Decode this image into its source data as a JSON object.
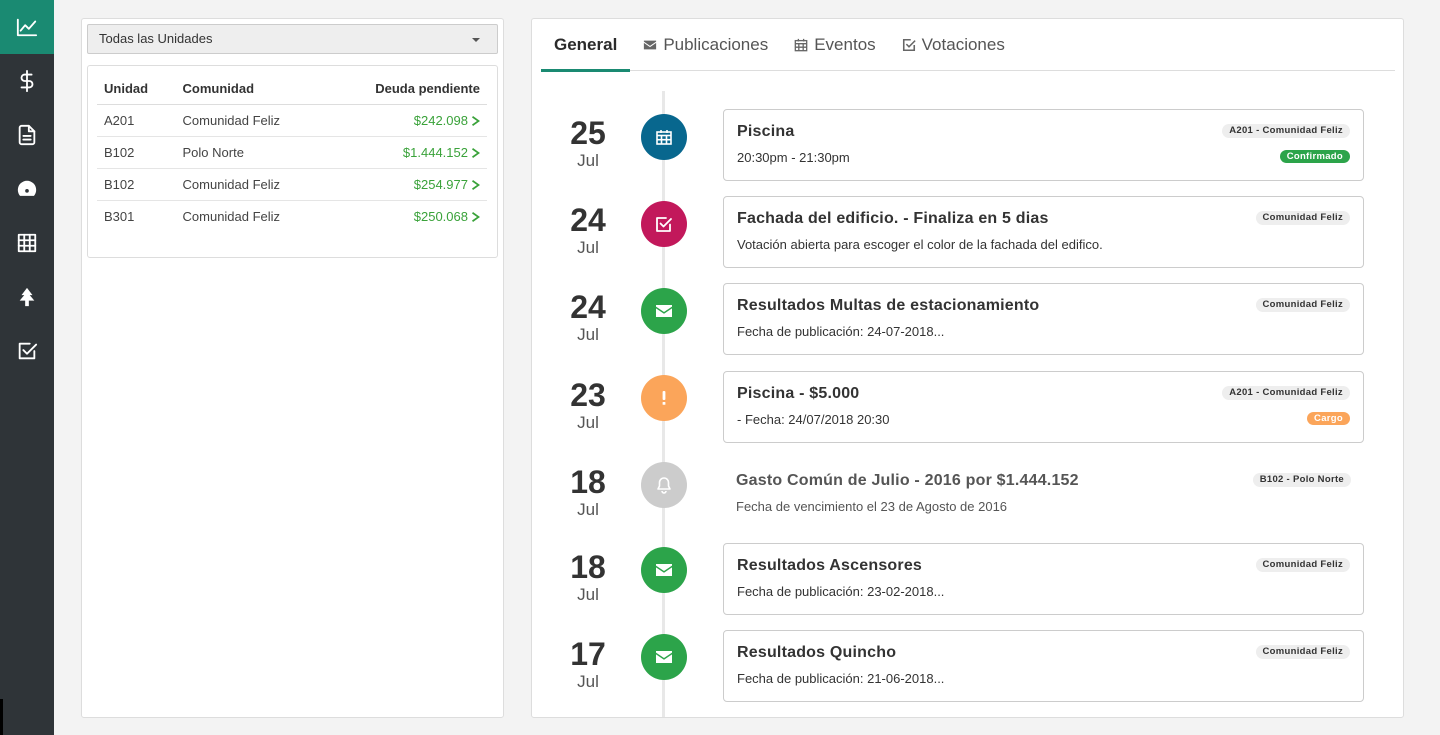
{
  "sidebar": {
    "items": [
      {
        "icon": "chart-line-icon",
        "active": true
      },
      {
        "icon": "dollar-icon",
        "active": false
      },
      {
        "icon": "document-icon",
        "active": false
      },
      {
        "icon": "dashboard-icon",
        "active": false
      },
      {
        "icon": "calendar-grid-icon",
        "active": false
      },
      {
        "icon": "tree-icon",
        "active": false
      },
      {
        "icon": "check-square-icon",
        "active": false
      }
    ]
  },
  "units": {
    "selected": "Todas las Unidades",
    "columns": [
      "Unidad",
      "Comunidad",
      "Deuda pendiente"
    ],
    "rows": [
      {
        "unit": "A201",
        "community": "Comunidad Feliz",
        "debt": "$242.098"
      },
      {
        "unit": "B102",
        "community": "Polo Norte",
        "debt": "$1.444.152"
      },
      {
        "unit": "B102",
        "community": "Comunidad Feliz",
        "debt": "$254.977"
      },
      {
        "unit": "B301",
        "community": "Comunidad Feliz",
        "debt": "$250.068"
      }
    ]
  },
  "tabs": [
    {
      "label": "General",
      "icon": "",
      "active": true
    },
    {
      "label": "Publicaciones",
      "icon": "envelope-icon",
      "active": false
    },
    {
      "label": "Eventos",
      "icon": "calendar-icon",
      "active": false
    },
    {
      "label": "Votaciones",
      "icon": "check-icon",
      "active": false
    }
  ],
  "colors": {
    "accent": "#1a8a72",
    "event": "#08678e",
    "vote": "#c2185b",
    "publication": "#2ca44a",
    "charge": "#fba55a",
    "expense": "#cccccc",
    "confirmed": "#2ca44a",
    "cargo": "#fba55a"
  },
  "timeline": [
    {
      "day": "25",
      "month": "Jul",
      "kind": "event",
      "icon": "calendar-icon",
      "title": "Piscina",
      "subtitle": "20:30pm - 21:30pm",
      "tag": "A201 - Comunidad Feliz",
      "badge": "Confirmado",
      "badge_color": "#2ca44a",
      "flat": false
    },
    {
      "day": "24",
      "month": "Jul",
      "kind": "vote",
      "icon": "check-square-icon",
      "title": "Fachada del edificio. - Finaliza en 5 dias",
      "subtitle": "Votación abierta para escoger el color de la fachada del edifico.",
      "tag": "Comunidad Feliz",
      "badge": "",
      "flat": false
    },
    {
      "day": "24",
      "month": "Jul",
      "kind": "publication",
      "icon": "envelope-icon",
      "title": "Resultados Multas de estacionamiento",
      "subtitle": "Fecha de publicación: 24-07-2018...",
      "tag": "Comunidad Feliz",
      "badge": "",
      "flat": false
    },
    {
      "day": "23",
      "month": "Jul",
      "kind": "charge",
      "icon": "exclamation-icon",
      "title": "Piscina - $5.000",
      "subtitle": "- Fecha: 24/07/2018 20:30",
      "tag": "A201 - Comunidad Feliz",
      "badge": "Cargo",
      "badge_color": "#fba55a",
      "flat": false
    },
    {
      "day": "18",
      "month": "Jul",
      "kind": "expense",
      "icon": "bell-icon",
      "title": "Gasto Común de Julio - 2016 por $1.444.152",
      "subtitle": "Fecha de vencimiento el 23 de Agosto de 2016",
      "tag": "B102 - Polo Norte",
      "badge": "",
      "flat": true
    },
    {
      "day": "18",
      "month": "Jul",
      "kind": "publication",
      "icon": "envelope-icon",
      "title": "Resultados Ascensores",
      "subtitle": "Fecha de publicación: 23-02-2018...",
      "tag": "Comunidad Feliz",
      "badge": "",
      "flat": false
    },
    {
      "day": "17",
      "month": "Jul",
      "kind": "publication",
      "icon": "envelope-icon",
      "title": "Resultados Quincho",
      "subtitle": "Fecha de publicación: 21-06-2018...",
      "tag": "Comunidad Feliz",
      "badge": "",
      "flat": false
    }
  ]
}
